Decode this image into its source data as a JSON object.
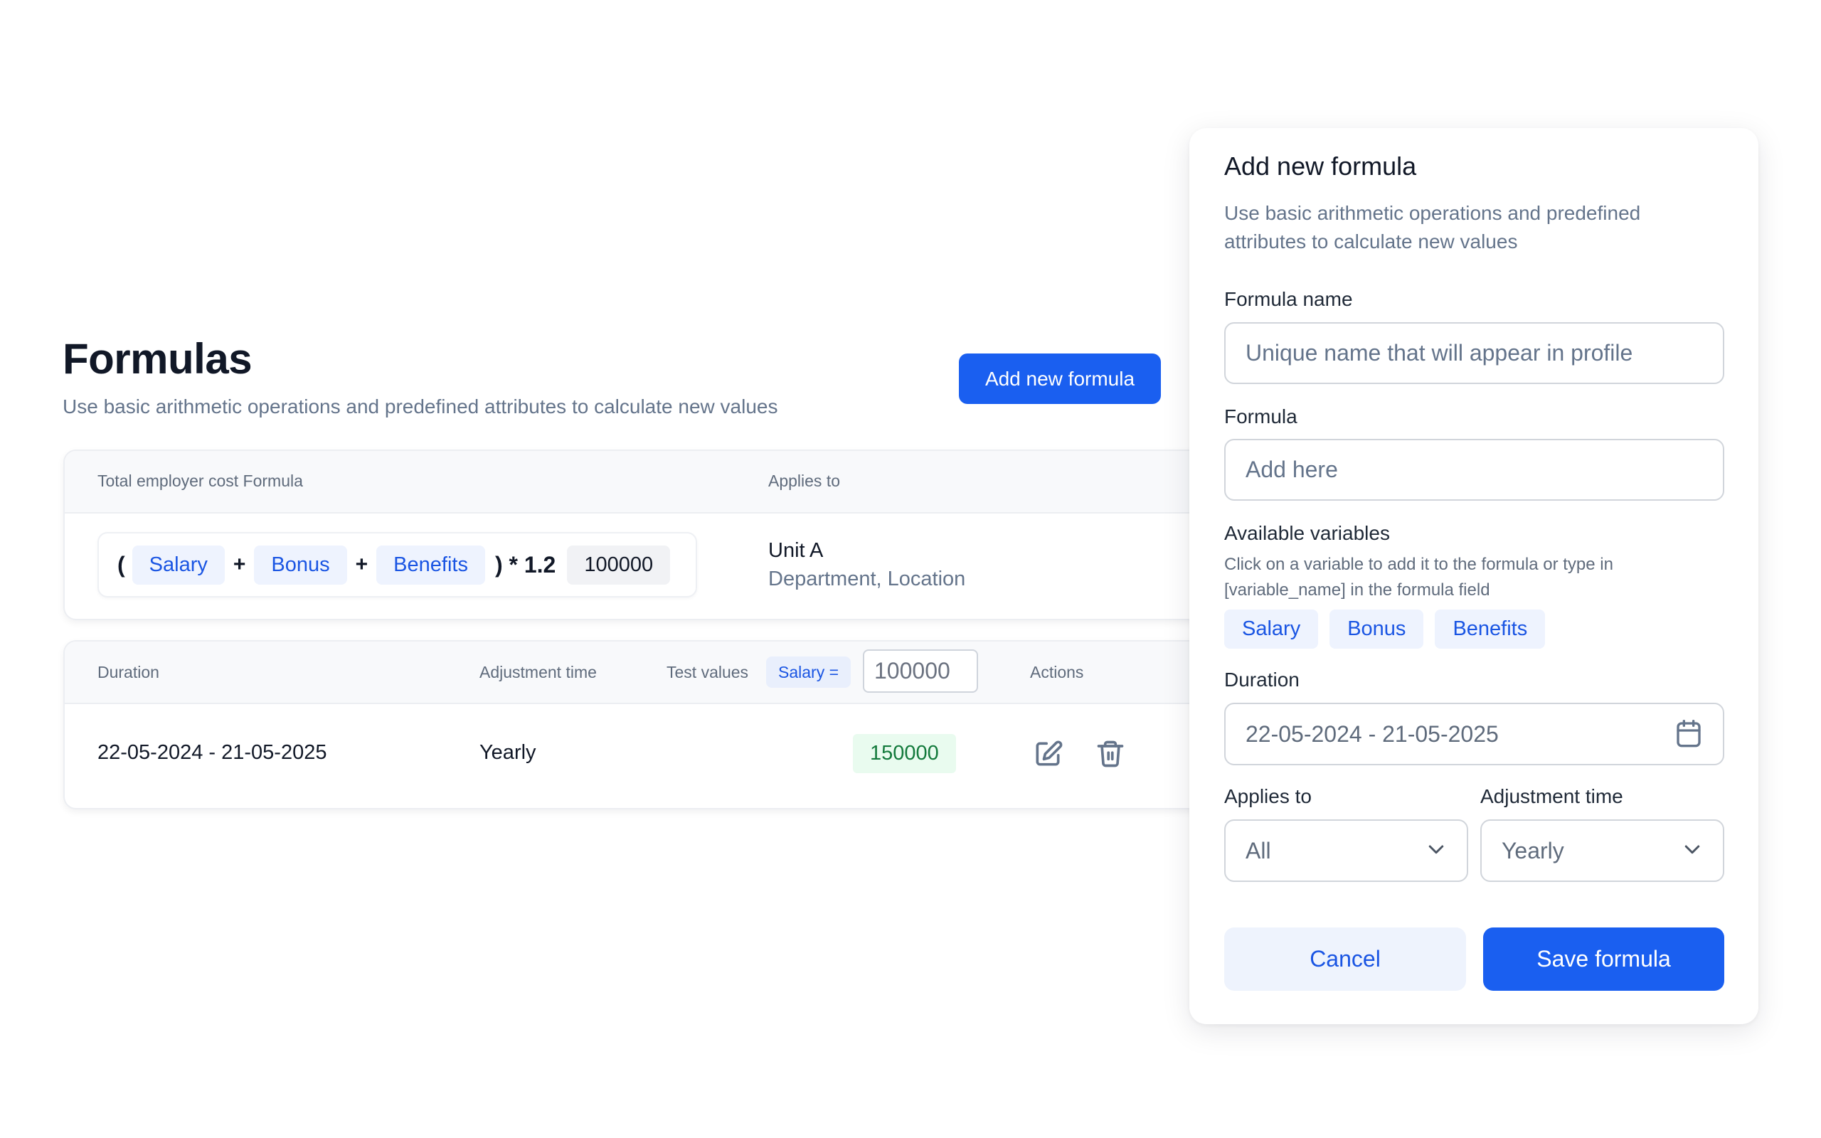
{
  "page": {
    "title": "Formulas",
    "subtitle": "Use basic arithmetic operations and predefined attributes to calculate new values",
    "add_button": "Add new formula"
  },
  "formula_table": {
    "headers": {
      "formula": "Total employer cost Formula",
      "applies_to": "Applies to"
    },
    "row": {
      "formula": {
        "open_paren": "(",
        "terms": [
          "Salary",
          "Bonus",
          "Benefits"
        ],
        "operator": "+",
        "close_multiplier": ") * 1.2",
        "value": "100000"
      },
      "applies_to_title": "Unit A",
      "applies_to_detail": "Department, Location"
    }
  },
  "schedule_table": {
    "headers": {
      "duration": "Duration",
      "adjustment_time": "Adjustment time",
      "test_values": "Test values",
      "test_chip": "Salary =",
      "test_input_value": "100000",
      "actions": "Actions"
    },
    "row": {
      "duration": "22-05-2024 - 21-05-2025",
      "adjustment_time": "Yearly",
      "result": "150000"
    },
    "actions": [
      "edit-icon",
      "trash-icon"
    ]
  },
  "panel": {
    "title": "Add new formula",
    "subtitle": "Use basic arithmetic operations and predefined attributes to calculate new values",
    "formula_name_label": "Formula name",
    "formula_name_placeholder": "Unique name that will appear in profile",
    "formula_label": "Formula",
    "formula_placeholder": "Add here",
    "variables_label": "Available variables",
    "variables_help": "Click on a variable to add it to the formula or type in [variable_name] in the formula field",
    "variables": [
      "Salary",
      "Bonus",
      "Benefits"
    ],
    "duration_label": "Duration",
    "duration_value": "22-05-2024 - 21-05-2025",
    "applies_to_label": "Applies to",
    "applies_to_value": "All",
    "adjustment_label": "Adjustment time",
    "adjustment_value": "Yearly",
    "cancel_label": "Cancel",
    "save_label": "Save formula"
  },
  "colors": {
    "primary": "#1a5ff0",
    "chip_bg": "#eef3fe",
    "chip_text": "#1a55e3",
    "success_bg": "#e9fbef",
    "success_text": "#137a3c"
  }
}
